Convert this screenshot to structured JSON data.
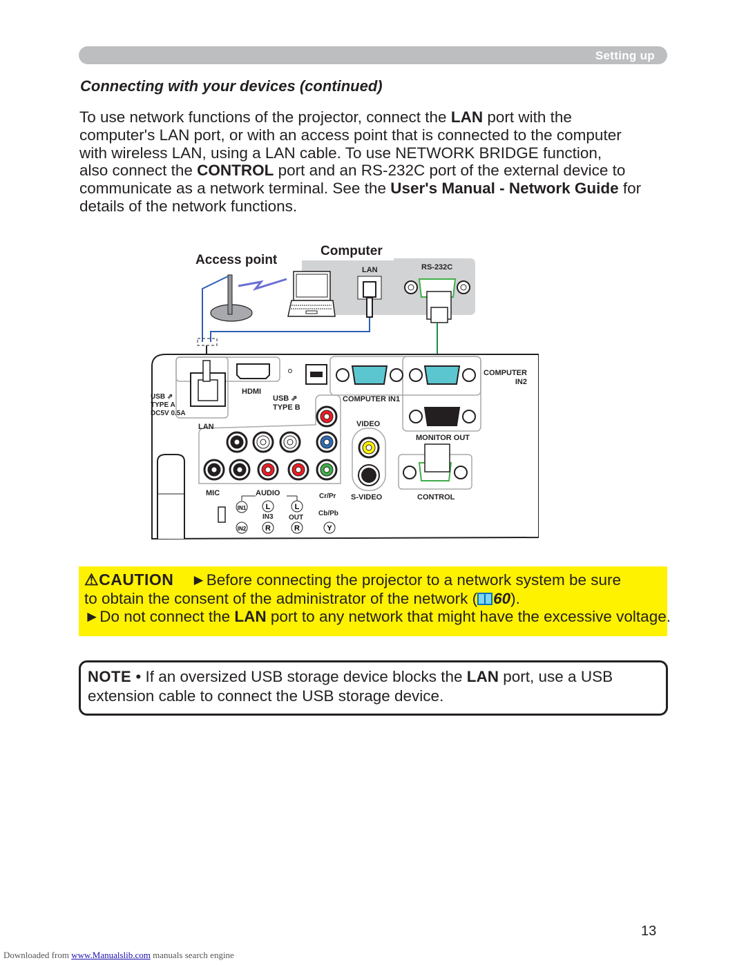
{
  "header": {
    "section": "Setting up"
  },
  "title": "Connecting with your devices (continued)",
  "intro": {
    "lines": [
      [
        "To use network functions of the projector, connect the ",
        {
          "b": "LAN"
        },
        " port with the"
      ],
      [
        "computer's LAN port, or with an access point that is connected to the computer"
      ],
      [
        "with wireless LAN, using a LAN cable. To use NETWORK BRIDGE function,"
      ],
      [
        "also connect the ",
        {
          "b": "CONTROL"
        },
        " port and an RS-232C port of the external device to"
      ],
      [
        "communicate as a network terminal. See the ",
        {
          "b": "User's Manual - Network Guide"
        },
        " for"
      ],
      [
        "details of the network functions."
      ]
    ]
  },
  "diagram": {
    "access_point_label": "Access point",
    "computer_label": "Computer",
    "computer_ports": {
      "lan": "LAN",
      "rs232c": "RS-232C"
    },
    "projector_ports": {
      "usb_type_a": [
        "USB",
        "TYPE A",
        "DC5V 0.5A"
      ],
      "lan": "LAN",
      "hdmi": "HDMI",
      "usb_type_b": [
        "USB",
        "TYPE B"
      ],
      "computer_in1": "COMPUTER IN1",
      "computer_in2": [
        "COMPUTER",
        "IN2"
      ],
      "monitor_out": "MONITOR OUT",
      "video": "VIDEO",
      "s_video": "S-VIDEO",
      "control": "CONTROL",
      "mic": "MIC",
      "audio": "AUDIO",
      "audio_in1": "IN1",
      "audio_in2": "IN2",
      "audio_in3": "IN3",
      "audio_out": "OUT",
      "left": "L",
      "right": "R",
      "cr_pr": "Cr/Pr",
      "cb_pb": "Cb/Pb",
      "y": "Y"
    },
    "colors": {
      "lan_cable": "#2b5fb4",
      "rs232_cable": "#1a8a4a",
      "vga_blue": "#5cc6d0",
      "computer_panel": "#d1d3d4"
    }
  },
  "caution": {
    "title": "CAUTION",
    "bullet1_a": "►Before connecting the projector to a network system be sure",
    "bullet1_b": "to obtain the consent of the administrator of the network (",
    "bullet1_ref": "60",
    "bullet1_end": ").",
    "bullet2_a": "►Do not connect the ",
    "bullet2_bold": "LAN",
    "bullet2_b": " port to any network that might have the excessive voltage.",
    "background": "#fff200"
  },
  "note": {
    "title": "NOTE",
    "line1_a": " • If an oversized USB storage device blocks the ",
    "line1_bold": "LAN",
    "line1_b": " port, use a USB",
    "line2": "extension cable to connect the USB storage device."
  },
  "page_number": "13",
  "footer": {
    "prefix": "Downloaded from ",
    "link": "www.Manualslib.com",
    "suffix": "  manuals search engine"
  }
}
